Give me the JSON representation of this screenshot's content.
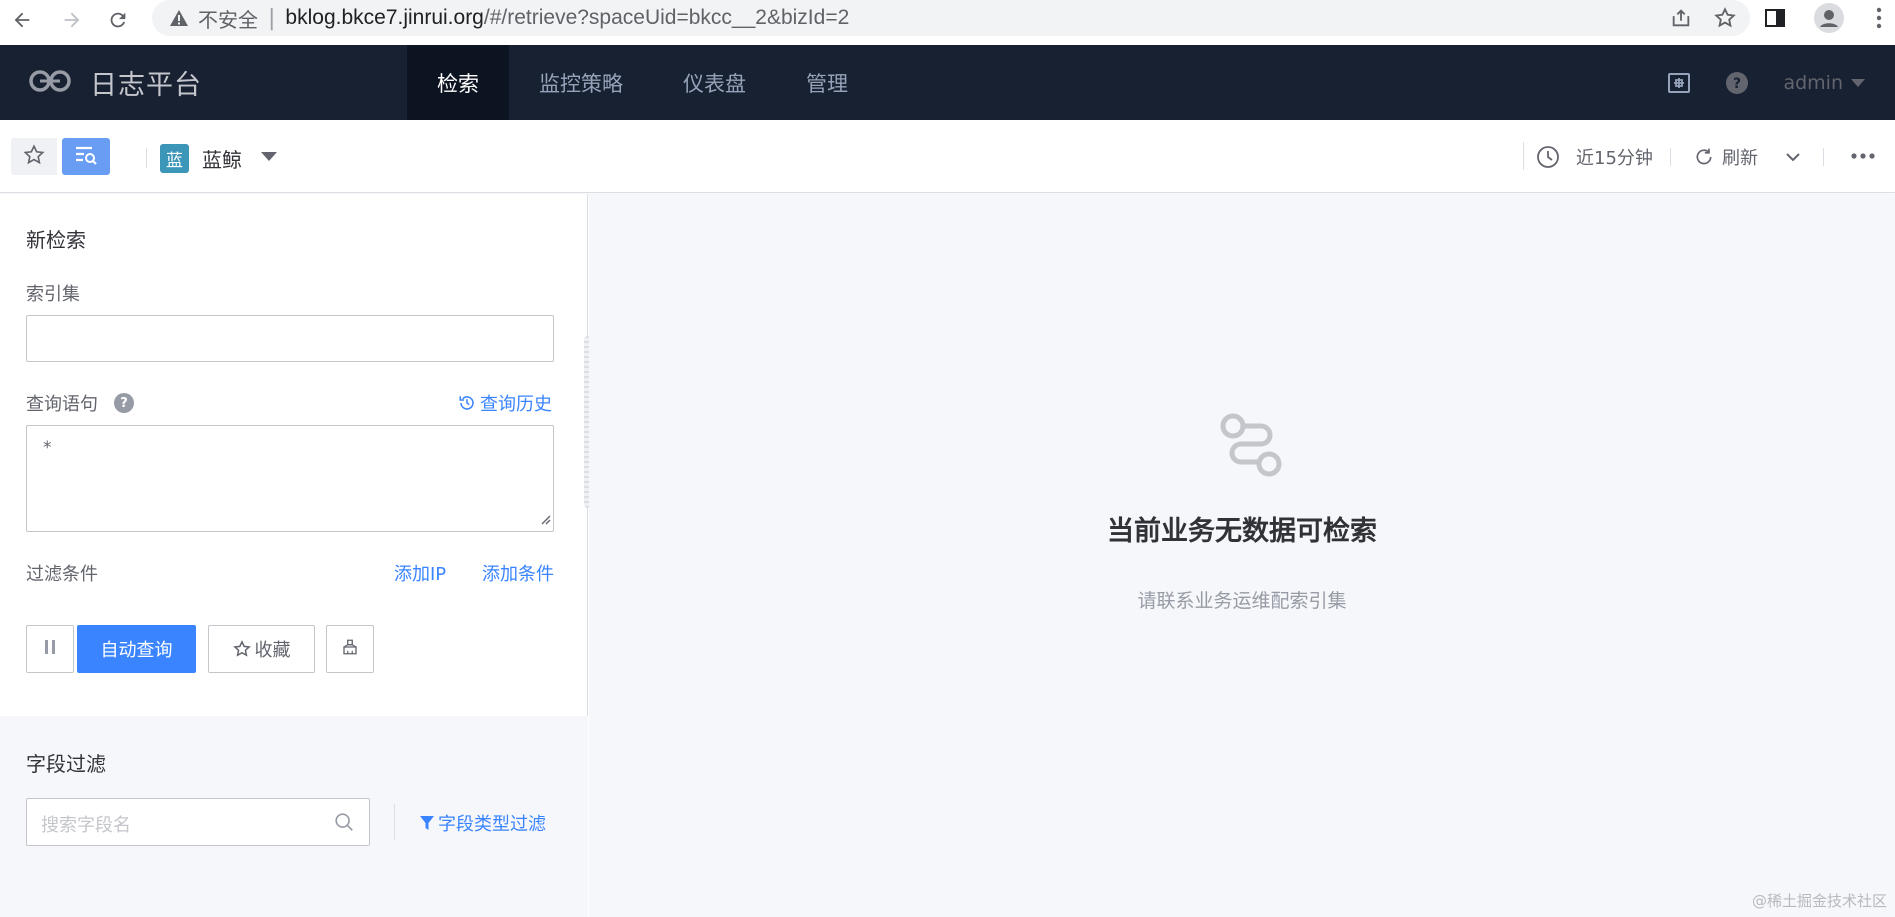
{
  "browser": {
    "security_label": "不安全",
    "url_host": "bklog.bkce7.jinrui.org",
    "url_path": "/#/retrieve?spaceUid=bkcc__2&bizId=2"
  },
  "topnav": {
    "app_title": "日志平台",
    "menu": [
      {
        "label": "检索",
        "active": true
      },
      {
        "label": "监控策略",
        "active": false
      },
      {
        "label": "仪表盘",
        "active": false
      },
      {
        "label": "管理",
        "active": false
      }
    ],
    "user": "admin"
  },
  "subbar": {
    "biz_icon_text": "蓝",
    "biz_name": "蓝鲸",
    "time_range": "近15分钟",
    "refresh_label": "刷新"
  },
  "left": {
    "new_search_title": "新检索",
    "index_set_label": "索引集",
    "index_set_value": "",
    "query_label": "查询语句",
    "query_history_link": "查询历史",
    "query_value": "*",
    "filter_label": "过滤条件",
    "add_ip_link": "添加IP",
    "add_condition_link": "添加条件",
    "auto_query_button": "自动查询",
    "favorite_button": "收藏",
    "field_filter_title": "字段过滤",
    "field_search_placeholder": "搜索字段名",
    "field_type_filter_link": "字段类型过滤"
  },
  "main": {
    "empty_title": "当前业务无数据可检索",
    "empty_subtitle": "请联系业务运维配索引集"
  },
  "watermark": "@稀土掘金技术社区",
  "colors": {
    "primary": "#3a84ff",
    "nav_bg": "#182132",
    "nav_active_bg": "#0c1421",
    "page_bg": "#f5f7fa"
  }
}
